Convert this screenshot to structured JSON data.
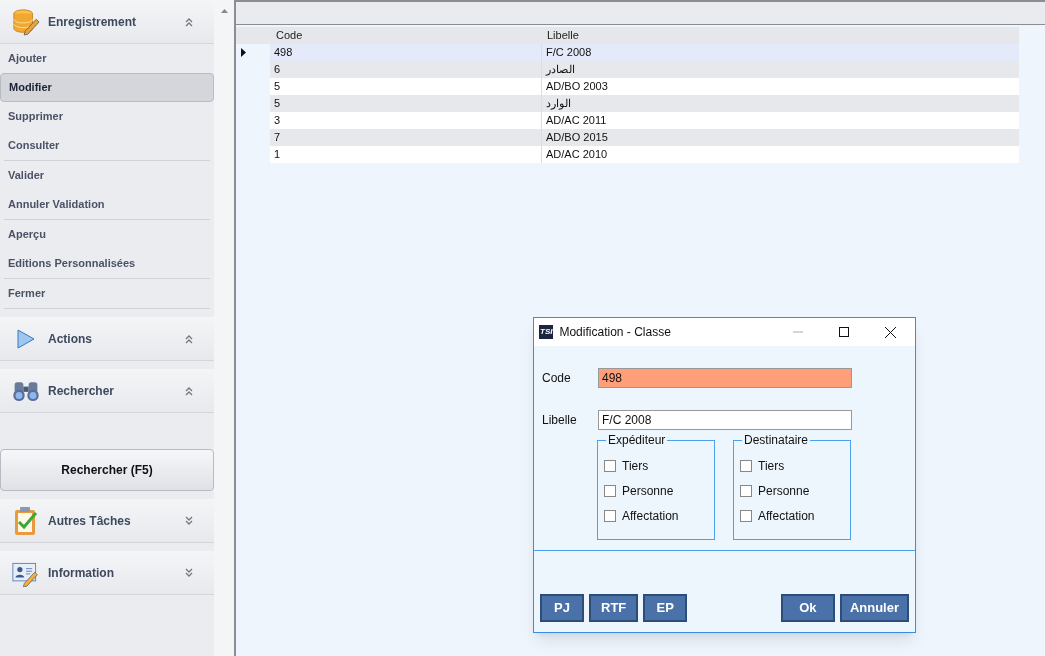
{
  "sidebar": {
    "sections": [
      {
        "title": "Enregistrement",
        "kind": "database",
        "expanded": true,
        "groups": [
          [
            {
              "label": "Ajouter",
              "selected": false
            },
            {
              "label": "Modifier",
              "selected": true
            },
            {
              "label": "Supprimer",
              "selected": false
            },
            {
              "label": "Consulter",
              "selected": false
            }
          ],
          [
            {
              "label": "Valider",
              "selected": false
            },
            {
              "label": "Annuler Validation",
              "selected": false
            }
          ],
          [
            {
              "label": "Aperçu",
              "selected": false
            },
            {
              "label": "Editions Personnalisées",
              "selected": false
            }
          ],
          [
            {
              "label": "Fermer",
              "selected": false
            }
          ]
        ]
      },
      {
        "title": "Actions",
        "kind": "play",
        "expanded": true
      },
      {
        "title": "Rechercher",
        "kind": "binoculars",
        "expanded": true,
        "button": "Rechercher (F5)"
      },
      {
        "title": "Autres Tâches",
        "kind": "clipboard",
        "expanded": false
      },
      {
        "title": "Information",
        "kind": "card",
        "expanded": false
      }
    ]
  },
  "table": {
    "columns": [
      "Code",
      "Libelle"
    ],
    "rows": [
      {
        "cells": [
          "498",
          "F/C 2008"
        ],
        "selected": true
      },
      {
        "cells": [
          "6",
          "الصادر"
        ],
        "selected": false
      },
      {
        "cells": [
          "5",
          "AD/BO 2003"
        ],
        "selected": false
      },
      {
        "cells": [
          "5",
          "الوارد"
        ],
        "selected": false
      },
      {
        "cells": [
          "3",
          "AD/AC 2011"
        ],
        "selected": false
      },
      {
        "cells": [
          "7",
          "AD/BO 2015"
        ],
        "selected": false
      },
      {
        "cells": [
          "1",
          "AD/AC 2010"
        ],
        "selected": false
      }
    ]
  },
  "dialog": {
    "logo": "TSI",
    "title": "Modification - Classe",
    "fields": [
      {
        "label": "Code",
        "value": "498",
        "highlighted": true
      },
      {
        "label": "Libelle",
        "value": "F/C 2008",
        "highlighted": false
      }
    ],
    "groups": [
      {
        "title": "Expéditeur",
        "options": [
          {
            "label": "Tiers",
            "checked": false
          },
          {
            "label": "Personne",
            "checked": false
          },
          {
            "label": "Affectation",
            "checked": false
          }
        ]
      },
      {
        "title": "Destinataire",
        "options": [
          {
            "label": "Tiers",
            "checked": false
          },
          {
            "label": "Personne",
            "checked": false
          },
          {
            "label": "Affectation",
            "checked": false
          }
        ]
      }
    ],
    "left_buttons": [
      "PJ",
      "RTF",
      "EP"
    ],
    "right_buttons": [
      "Ok",
      "Annuler"
    ]
  }
}
